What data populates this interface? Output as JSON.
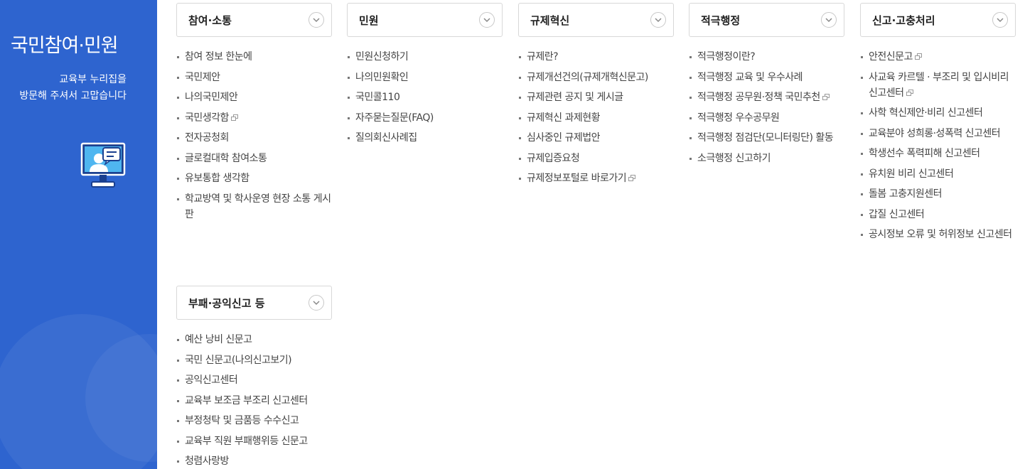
{
  "sidebar": {
    "title": "국민참여·민원",
    "greeting_line1": "교육부 누리집을",
    "greeting_line2": "방문해 주셔서 고맙습니다"
  },
  "columns": [
    {
      "title": "참여·소통",
      "items": [
        {
          "label": "참여 정보 한눈에",
          "external": false
        },
        {
          "label": "국민제안",
          "external": false
        },
        {
          "label": "나의국민제안",
          "external": false
        },
        {
          "label": "국민생각함",
          "external": true
        },
        {
          "label": "전자공청회",
          "external": false
        },
        {
          "label": "글로컬대학 참여소통",
          "external": false
        },
        {
          "label": "유보통합 생각함",
          "external": false
        },
        {
          "label": "학교방역 및 학사운영 현장 소통 게시판",
          "external": false
        }
      ]
    },
    {
      "title": "민원",
      "items": [
        {
          "label": "민원신청하기",
          "external": false
        },
        {
          "label": "나의민원확인",
          "external": false
        },
        {
          "label": "국민콜110",
          "external": false
        },
        {
          "label": "자주묻는질문(FAQ)",
          "external": false
        },
        {
          "label": "질의회신사례집",
          "external": false
        }
      ]
    },
    {
      "title": "규제혁신",
      "items": [
        {
          "label": "규제란?",
          "external": false
        },
        {
          "label": "규제개선건의(규제개혁신문고)",
          "external": false
        },
        {
          "label": "규제관련 공지 및 게시글",
          "external": false
        },
        {
          "label": "규제혁신 과제현황",
          "external": false
        },
        {
          "label": "심사중인 규제법안",
          "external": false
        },
        {
          "label": "규제입증요청",
          "external": false
        },
        {
          "label": "규제정보포털로 바로가기",
          "external": true
        }
      ]
    },
    {
      "title": "적극행정",
      "items": [
        {
          "label": "적극행정이란?",
          "external": false
        },
        {
          "label": "적극행정 교육 및 우수사례",
          "external": false
        },
        {
          "label": "적극행정 공무원·정책 국민추천",
          "external": true
        },
        {
          "label": "적극행정 우수공무원",
          "external": false
        },
        {
          "label": "적극행정 점검단(모니터링단) 활동",
          "external": false
        },
        {
          "label": "소극행정 신고하기",
          "external": false
        }
      ]
    },
    {
      "title": "신고·고충처리",
      "items": [
        {
          "label": "안전신문고",
          "external": true
        },
        {
          "label": "사교육 카르텔 · 부조리 및 입시비리 신고센터",
          "external": true
        },
        {
          "label": "사학 혁신제안·비리 신고센터",
          "external": false
        },
        {
          "label": "교육분야 성희롱·성폭력 신고센터",
          "external": false
        },
        {
          "label": "학생선수 폭력피해 신고센터",
          "external": false
        },
        {
          "label": "유치원 비리 신고센터",
          "external": false
        },
        {
          "label": "돌봄 고충지원센터",
          "external": false
        },
        {
          "label": "갑질 신고센터",
          "external": false
        },
        {
          "label": "공시정보 오류 및 허위정보 신고센터",
          "external": false
        }
      ]
    },
    {
      "title": "부패·공익신고 등",
      "items": [
        {
          "label": "예산 낭비 신문고",
          "external": false
        },
        {
          "label": "국민 신문고(나의신고보기)",
          "external": false
        },
        {
          "label": "공익신고센터",
          "external": false
        },
        {
          "label": "교육부 보조금 부조리 신고센터",
          "external": false
        },
        {
          "label": "부정청탁 및 금품등 수수신고",
          "external": false
        },
        {
          "label": "교육부 직원 부패행위등 신문고",
          "external": false
        },
        {
          "label": "청렴사랑방",
          "external": false
        }
      ]
    }
  ],
  "icons": {
    "toggle": "chevron-down-icon",
    "external": "new-window-icon",
    "illustration": "monitor-chat-icon"
  },
  "colors": {
    "sidebar_bg": "#2e64cf",
    "text": "#444444",
    "border": "#d8d8d8"
  }
}
